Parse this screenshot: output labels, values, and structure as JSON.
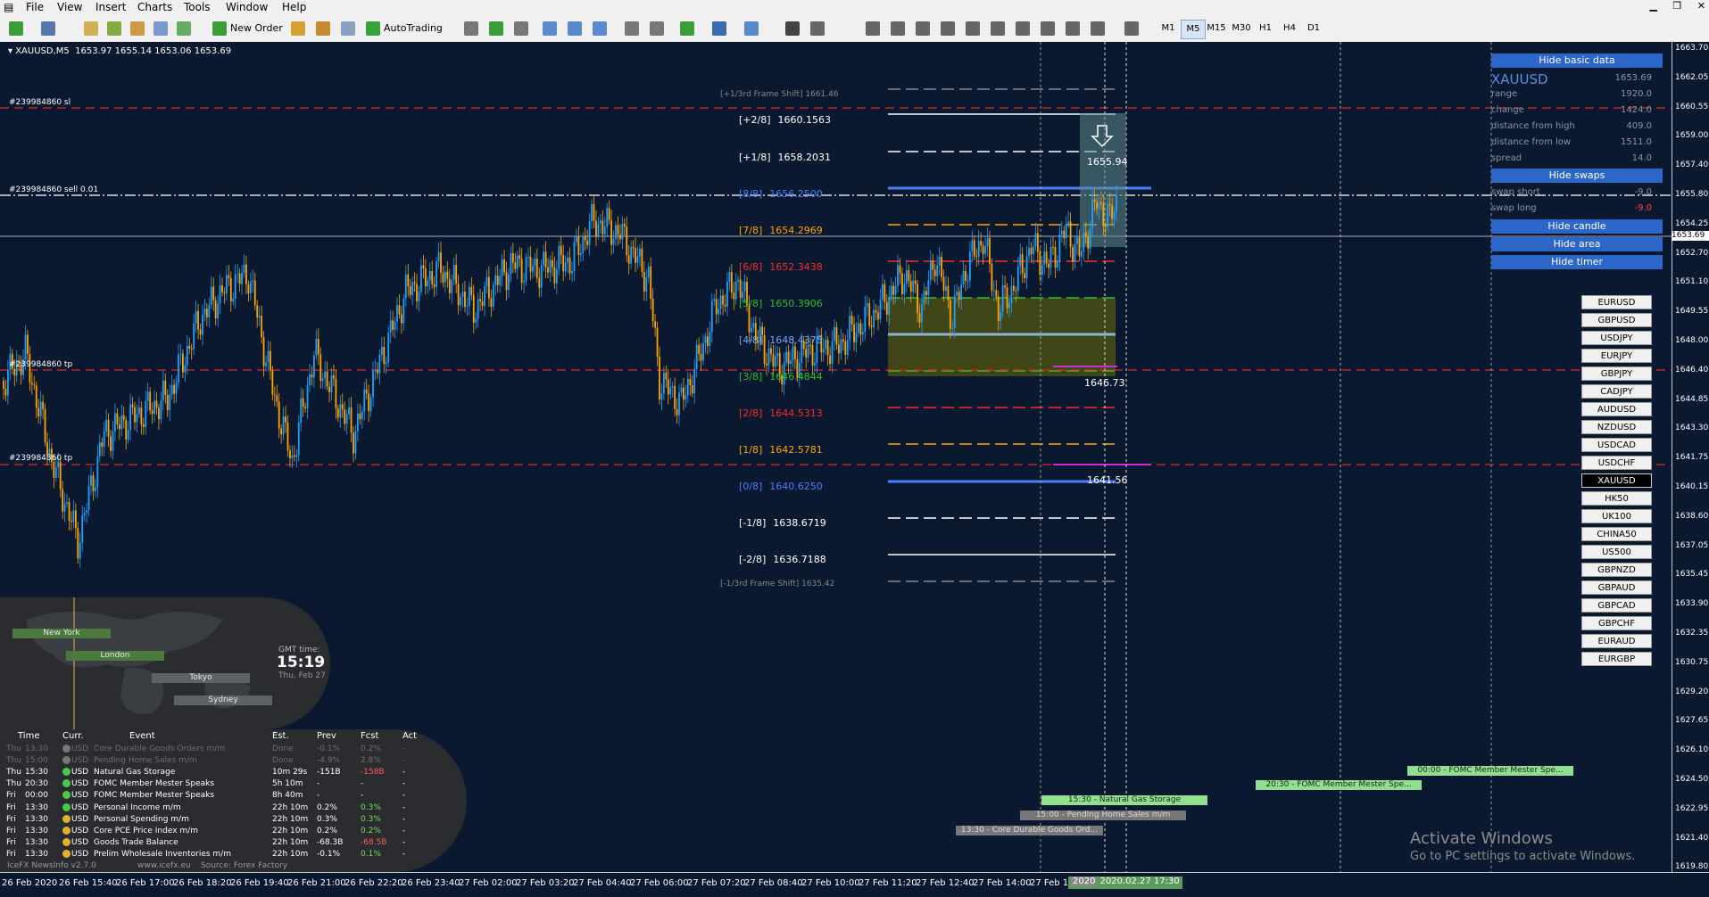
{
  "menu": [
    "File",
    "View",
    "Insert",
    "Charts",
    "Tools",
    "Window",
    "Help"
  ],
  "toolbar": {
    "new_order": "New Order",
    "autotrading": "AutoTrading",
    "timeframes": [
      "M1",
      "M5",
      "M15",
      "M30",
      "H1",
      "H4",
      "D1"
    ],
    "active_tf": "M5"
  },
  "chart_header": {
    "symbol": "XAUUSD,M5",
    "ohlc": "1653.97 1655.14 1653.06 1653.69"
  },
  "price_axis": {
    "labels": [
      "1663.70",
      "1662.05",
      "1660.55",
      "1659.00",
      "1657.40",
      "1655.80",
      "1654.25",
      "1652.70",
      "1651.10",
      "1649.55",
      "1648.00",
      "1646.40",
      "1644.85",
      "1643.30",
      "1641.75",
      "1640.15",
      "1638.60",
      "1637.05",
      "1635.45",
      "1633.90",
      "1632.35",
      "1630.75",
      "1629.20",
      "1627.65",
      "1626.10",
      "1624.50",
      "1622.95",
      "1621.40",
      "1619.80"
    ],
    "current": "1653.69"
  },
  "time_axis": {
    "labels": [
      "26 Feb 2020",
      "26 Feb 15:40",
      "26 Feb 17:00",
      "26 Feb 18:20",
      "26 Feb 19:40",
      "26 Feb 21:00",
      "26 Feb 22:20",
      "26 Feb 23:40",
      "27 Feb 02:00",
      "27 Feb 03:20",
      "27 Feb 04:40",
      "27 Feb 06:00",
      "27 Feb 07:20",
      "27 Feb 08:40",
      "27 Feb 10:00",
      "27 Feb 11:20",
      "27 Feb 12:40",
      "27 Feb 14:00",
      "27 Feb 15"
    ],
    "highlight": "2020.02.27 17:30",
    "highlight_prefix": "2020"
  },
  "murrey": {
    "frame_top": "[+1/3rd Frame Shift]  1661.46",
    "frame_bottom": "[-1/3rd Frame Shift]  1635.42",
    "levels": [
      {
        "tag": "[+2/8]",
        "value": "1660.1563",
        "color": "#ffffff"
      },
      {
        "tag": "[+1/8]",
        "value": "1658.2031",
        "color": "#ffffff"
      },
      {
        "tag": "[8/8]",
        "value": "1656.2500",
        "color": "#4a7fff"
      },
      {
        "tag": "[7/8]",
        "value": "1654.2969",
        "color": "#ffa500"
      },
      {
        "tag": "[6/8]",
        "value": "1652.3438",
        "color": "#ff2a2a"
      },
      {
        "tag": "[5/8]",
        "value": "1650.3906",
        "color": "#2fbf2f"
      },
      {
        "tag": "[4/8]",
        "value": "1648.4375",
        "color": "#6fa8ff"
      },
      {
        "tag": "[3/8]",
        "value": "1646.4844",
        "color": "#2fbf2f"
      },
      {
        "tag": "[2/8]",
        "value": "1644.5313",
        "color": "#ff2a2a"
      },
      {
        "tag": "[1/8]",
        "value": "1642.5781",
        "color": "#ffa500"
      },
      {
        "tag": "[0/8]",
        "value": "1640.6250",
        "color": "#4a7fff"
      },
      {
        "tag": "[-1/8]",
        "value": "1638.6719",
        "color": "#ffffff"
      },
      {
        "tag": "[-2/8]",
        "value": "1636.7188",
        "color": "#ffffff"
      }
    ]
  },
  "order_labels": {
    "sl": "#239984860 sl",
    "sell": "#239984860 sell 0.01",
    "tp1": "#239984860 tp",
    "tp2": "#239984860 tp"
  },
  "price_labels": {
    "high": "1655.94",
    "mid": "1646.73",
    "low": "1641.56"
  },
  "info_panel": {
    "hide_basic": "Hide basic data",
    "symbol": "XAUUSD",
    "price": "1653.69",
    "rows": [
      {
        "k": "range",
        "v": "1920.0"
      },
      {
        "k": "change",
        "v": "1424.0"
      },
      {
        "k": "distance from high",
        "v": "409.0"
      },
      {
        "k": "distance from low",
        "v": "1511.0"
      },
      {
        "k": "spread",
        "v": "14.0"
      }
    ],
    "hide_swaps": "Hide swaps",
    "swaps": [
      {
        "k": "swap short",
        "v": "-9.0"
      },
      {
        "k": "swap long",
        "v": "-9.0"
      }
    ],
    "hide_candle": "Hide candle",
    "hide_area": "Hide area",
    "hide_timer": "Hide timer"
  },
  "symbols": [
    "EURUSD",
    "GBPUSD",
    "USDJPY",
    "EURJPY",
    "GBPJPY",
    "CADJPY",
    "AUDUSD",
    "NZDUSD",
    "USDCAD",
    "USDCHF",
    "XAUUSD",
    "HK50",
    "UK100",
    "CHINA50",
    "US500",
    "GBPNZD",
    "GBPAUD",
    "GBPCAD",
    "GBPCHF",
    "EURAUD",
    "EURGBP"
  ],
  "selected_symbol": "XAUUSD",
  "world_clock": {
    "sessions": [
      "New York",
      "London",
      "Tokyo",
      "Sydney"
    ],
    "gmt_label": "GMT time:",
    "gmt_time": "15:19",
    "gmt_date": "Thu, Feb 27"
  },
  "news": {
    "headers": [
      "Time",
      "Curr.",
      "Event",
      "Est.",
      "Prev",
      "Fcst",
      "Act"
    ],
    "rows": [
      {
        "day": "Thu",
        "time": "13:30",
        "curr": "USD",
        "event": "Core Durable Goods Orders m/m",
        "est": "Done",
        "prev": "-0.1%",
        "fcst": "0.2%",
        "act": "-",
        "status": "past"
      },
      {
        "day": "Thu",
        "time": "15:00",
        "curr": "USD",
        "event": "Pending Home Sales m/m",
        "est": "Done",
        "prev": "-4.9%",
        "fcst": "2.8%",
        "act": "-",
        "status": "past"
      },
      {
        "day": "Thu",
        "time": "15:30",
        "curr": "USD",
        "event": "Natural Gas Storage",
        "est": "10m 29s",
        "prev": "-151B",
        "fcst": "-158B",
        "act": "-",
        "status": "low"
      },
      {
        "day": "Thu",
        "time": "20:30",
        "curr": "USD",
        "event": "FOMC Member Mester Speaks",
        "est": "5h 10m",
        "prev": "-",
        "fcst": "-",
        "act": "-",
        "status": "low"
      },
      {
        "day": "Fri",
        "time": "00:00",
        "curr": "USD",
        "event": "FOMC Member Mester Speaks",
        "est": "8h 40m",
        "prev": "-",
        "fcst": "-",
        "act": "-",
        "status": "low"
      },
      {
        "day": "Fri",
        "time": "13:30",
        "curr": "USD",
        "event": "Personal Income m/m",
        "est": "22h 10m",
        "prev": "0.2%",
        "fcst": "0.3%",
        "act": "-",
        "status": "low"
      },
      {
        "day": "Fri",
        "time": "13:30",
        "curr": "USD",
        "event": "Personal Spending m/m",
        "est": "22h 10m",
        "prev": "0.3%",
        "fcst": "0.3%",
        "act": "-",
        "status": "med"
      },
      {
        "day": "Fri",
        "time": "13:30",
        "curr": "USD",
        "event": "Core PCE Price Index m/m",
        "est": "22h 10m",
        "prev": "0.2%",
        "fcst": "0.2%",
        "act": "-",
        "status": "med"
      },
      {
        "day": "Fri",
        "time": "13:30",
        "curr": "USD",
        "event": "Goods Trade Balance",
        "est": "22h 10m",
        "prev": "-68.3B",
        "fcst": "-68.5B",
        "act": "-",
        "status": "med"
      },
      {
        "day": "Fri",
        "time": "13:30",
        "curr": "USD",
        "event": "Prelim Wholesale Inventories m/m",
        "est": "22h 10m",
        "prev": "-0.1%",
        "fcst": "0.1%",
        "act": "-",
        "status": "med"
      }
    ],
    "footer_left": "IceFX NewsInfo v2.7.0",
    "footer_mid": "www.icefx.eu",
    "footer_right": "Source: Forex Factory"
  },
  "event_labels": [
    "00:00 - FOMC Member Mester Spe...",
    "20:30 - FOMC Member Mester Spe...",
    "15:30 - Natural Gas Storage",
    "15:00 - Pending Home Sales m/m",
    "13:30 - Core Durable Goods Ord..."
  ],
  "watermark": {
    "line1": "Activate Windows",
    "line2": "Go to PC settings to activate Windows."
  }
}
